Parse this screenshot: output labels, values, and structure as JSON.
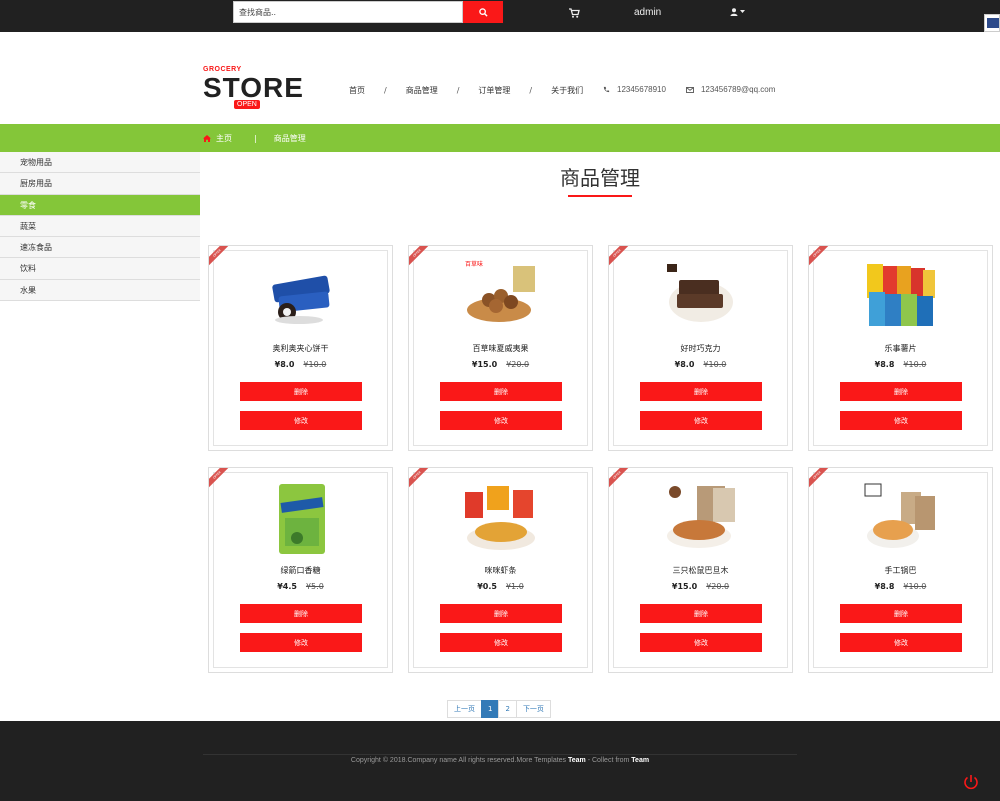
{
  "topbar": {
    "search_placeholder": "查找商品..",
    "username": "admin"
  },
  "logo": {
    "small": "GROCERY",
    "big": "STORE",
    "badge": "OPEN"
  },
  "nav": {
    "items": [
      "首页",
      "商品管理",
      "订单管理",
      "关于我们"
    ]
  },
  "contact": {
    "phone": "12345678910",
    "email": "123456789@qq.com"
  },
  "breadcrumb": {
    "home": "主页",
    "current": "商品管理"
  },
  "sidebar": {
    "items": [
      "宠物用品",
      "厨房用品",
      "零食",
      "蔬菜",
      "速冻食品",
      "饮料",
      "水果"
    ],
    "active_index": 2
  },
  "page_title": "商品管理",
  "products": [
    {
      "name": "奥利奥夹心饼干",
      "price": "¥8.0",
      "old_price": "¥10.0",
      "ribbon": "OFFER"
    },
    {
      "name": "百草味夏威夷果",
      "price": "¥15.0",
      "old_price": "¥20.0",
      "ribbon": "OFFER"
    },
    {
      "name": "好时巧克力",
      "price": "¥8.0",
      "old_price": "¥10.0",
      "ribbon": "OFFER"
    },
    {
      "name": "乐事薯片",
      "price": "¥8.8",
      "old_price": "¥10.0",
      "ribbon": "OFFER"
    },
    {
      "name": "绿箭口香糖",
      "price": "¥4.5",
      "old_price": "¥5.0",
      "ribbon": "OFFER"
    },
    {
      "name": "咪咪虾条",
      "price": "¥0.5",
      "old_price": "¥1.0",
      "ribbon": "OFFER"
    },
    {
      "name": "三只松鼠巴旦木",
      "price": "¥15.0",
      "old_price": "¥20.0",
      "ribbon": "OFFER"
    },
    {
      "name": "手工锅巴",
      "price": "¥8.8",
      "old_price": "¥10.0",
      "ribbon": "OFFER"
    }
  ],
  "buttons": {
    "delete": "删除",
    "edit": "修改"
  },
  "pagination": {
    "prev": "上一页",
    "pages": [
      "1",
      "2"
    ],
    "active": "1",
    "next": "下一页"
  },
  "footer": {
    "copy_prefix": "Copyright © 2018.Company name All rights reserved.More Templates ",
    "link1": "Team",
    "copy_middle": " - Collect from ",
    "link2": "Team"
  },
  "colors": {
    "accent_red": "#fa1818",
    "green": "#84c639",
    "dark": "#212121"
  }
}
